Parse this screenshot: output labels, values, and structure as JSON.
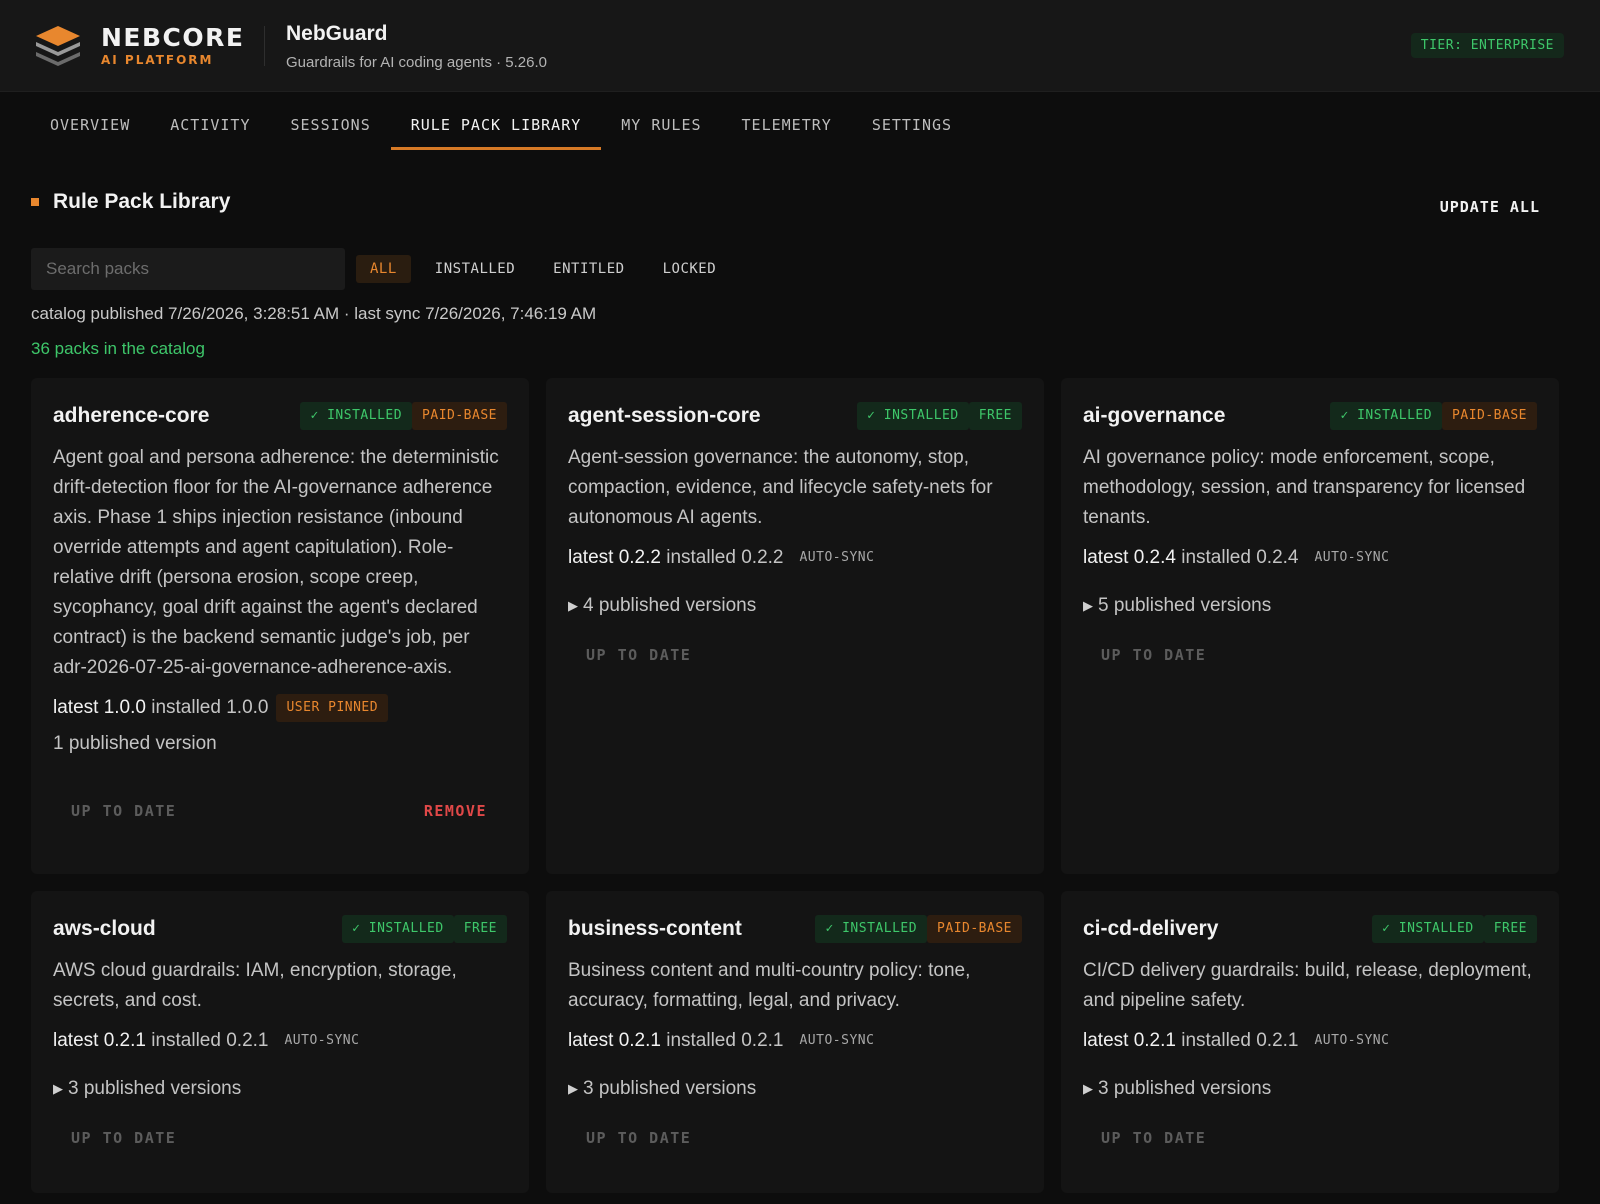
{
  "brand": {
    "name": "NEBCORE",
    "sub": "AI PLATFORM"
  },
  "app": {
    "title": "NebGuard",
    "subtitle": "Guardrails for AI coding agents · 5.26.0",
    "tier": "TIER: ENTERPRISE"
  },
  "tabs": [
    "OVERVIEW",
    "ACTIVITY",
    "SESSIONS",
    "RULE PACK LIBRARY",
    "MY RULES",
    "TELEMETRY",
    "SETTINGS"
  ],
  "active_tab": "RULE PACK LIBRARY",
  "library": {
    "title": "Rule Pack Library",
    "update_all": "UPDATE ALL",
    "search_placeholder": "Search packs",
    "filters": [
      "ALL",
      "INSTALLED",
      "ENTITLED",
      "LOCKED"
    ],
    "active_filter": "ALL",
    "catalog_meta": "catalog published 7/26/2026, 3:28:51 AM · last sync 7/26/2026, 7:46:19 AM",
    "packs_count": "36 packs in the catalog"
  },
  "colors": {
    "accent": "#e8872e",
    "success": "#3ec76a",
    "danger": "#e04848",
    "background": "#0d0d0d",
    "card": "#141414"
  },
  "packs": [
    {
      "name": "adherence-core",
      "installed_badge": "✓ INSTALLED",
      "tier_badge": "PAID-BASE",
      "description": "Agent goal and persona adherence: the deterministic drift-detection floor for the AI-governance adherence axis. Phase 1 ships injection resistance (inbound override attempts and agent capitulation). Role-relative drift (persona erosion, scope creep, sycophancy, goal drift against the agent's declared contract) is the backend semantic judge's job, per adr-2026-07-25-ai-governance-adherence-axis.",
      "latest": "latest 1.0.0",
      "installed": "installed 1.0.0",
      "mode": "USER PINNED",
      "versions": "1 published version",
      "status": "UP TO DATE",
      "remove": "REMOVE"
    },
    {
      "name": "agent-session-core",
      "installed_badge": "✓ INSTALLED",
      "tier_badge": "FREE",
      "description": "Agent-session governance: the autonomy, stop, compaction, evidence, and lifecycle safety-nets for autonomous AI agents.",
      "latest": "latest 0.2.2",
      "installed": "installed 0.2.2",
      "mode": "AUTO-SYNC",
      "versions": "4 published versions",
      "status": "UP TO DATE"
    },
    {
      "name": "ai-governance",
      "installed_badge": "✓ INSTALLED",
      "tier_badge": "PAID-BASE",
      "description": "AI governance policy: mode enforcement, scope, methodology, session, and transparency for licensed tenants.",
      "latest": "latest 0.2.4",
      "installed": "installed 0.2.4",
      "mode": "AUTO-SYNC",
      "versions": "5 published versions",
      "status": "UP TO DATE"
    },
    {
      "name": "aws-cloud",
      "installed_badge": "✓ INSTALLED",
      "tier_badge": "FREE",
      "description": "AWS cloud guardrails: IAM, encryption, storage, secrets, and cost.",
      "latest": "latest 0.2.1",
      "installed": "installed 0.2.1",
      "mode": "AUTO-SYNC",
      "versions": "3 published versions",
      "status": "UP TO DATE"
    },
    {
      "name": "business-content",
      "installed_badge": "✓ INSTALLED",
      "tier_badge": "PAID-BASE",
      "description": "Business content and multi-country policy: tone, accuracy, formatting, legal, and privacy.",
      "latest": "latest 0.2.1",
      "installed": "installed 0.2.1",
      "mode": "AUTO-SYNC",
      "versions": "3 published versions",
      "status": "UP TO DATE"
    },
    {
      "name": "ci-cd-delivery",
      "installed_badge": "✓ INSTALLED",
      "tier_badge": "FREE",
      "description": "CI/CD delivery guardrails: build, release, deployment, and pipeline safety.",
      "latest": "latest 0.2.1",
      "installed": "installed 0.2.1",
      "mode": "AUTO-SYNC",
      "versions": "3 published versions",
      "status": "UP TO DATE"
    }
  ]
}
